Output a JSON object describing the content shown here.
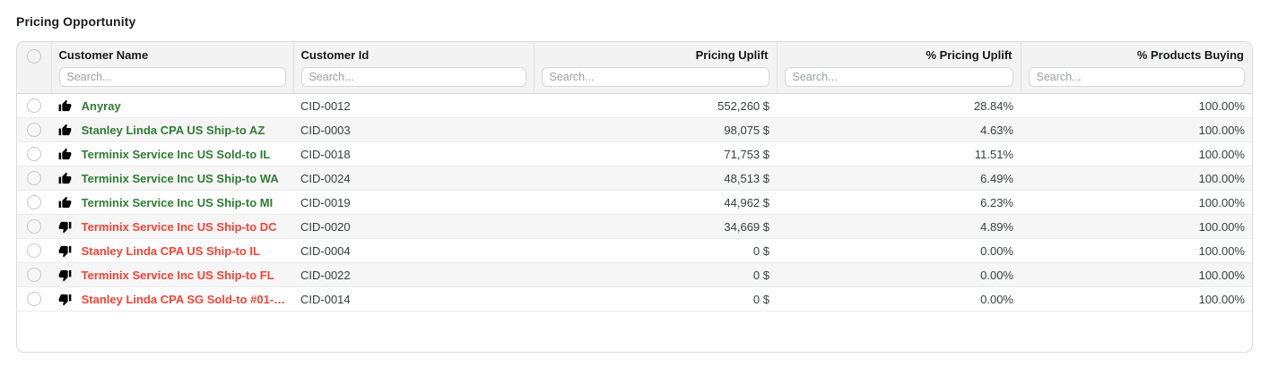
{
  "title": "Pricing Opportunity",
  "colors": {
    "positive": "#2e7d32",
    "negative": "#f44336",
    "thumb": "#f0b13c"
  },
  "table": {
    "search_placeholder": "Search...",
    "columns": [
      {
        "label": "Customer Name"
      },
      {
        "label": "Customer Id"
      },
      {
        "label": "Pricing Uplift"
      },
      {
        "label": "% Pricing Uplift"
      },
      {
        "label": "% Products Buying"
      }
    ],
    "rows": [
      {
        "sentiment": "up",
        "customer_name": "Anyray",
        "customer_id": "CID-0012",
        "pricing_uplift": "552,260 $",
        "pct_pricing_uplift": "28.84%",
        "pct_products_buying": "100.00%"
      },
      {
        "sentiment": "up",
        "customer_name": "Stanley Linda CPA US Ship-to AZ",
        "customer_id": "CID-0003",
        "pricing_uplift": "98,075 $",
        "pct_pricing_uplift": "4.63%",
        "pct_products_buying": "100.00%"
      },
      {
        "sentiment": "up",
        "customer_name": "Terminix Service Inc US Sold-to IL",
        "customer_id": "CID-0018",
        "pricing_uplift": "71,753 $",
        "pct_pricing_uplift": "11.51%",
        "pct_products_buying": "100.00%"
      },
      {
        "sentiment": "up",
        "customer_name": "Terminix Service Inc US Ship-to WA",
        "customer_id": "CID-0024",
        "pricing_uplift": "48,513 $",
        "pct_pricing_uplift": "6.49%",
        "pct_products_buying": "100.00%"
      },
      {
        "sentiment": "up",
        "customer_name": "Terminix Service Inc US Ship-to MI",
        "customer_id": "CID-0019",
        "pricing_uplift": "44,962 $",
        "pct_pricing_uplift": "6.23%",
        "pct_products_buying": "100.00%"
      },
      {
        "sentiment": "down",
        "customer_name": "Terminix Service Inc US Ship-to DC",
        "customer_id": "CID-0020",
        "pricing_uplift": "34,669 $",
        "pct_pricing_uplift": "4.89%",
        "pct_products_buying": "100.00%"
      },
      {
        "sentiment": "down",
        "customer_name": "Stanley Linda CPA US Ship-to IL",
        "customer_id": "CID-0004",
        "pricing_uplift": "0 $",
        "pct_pricing_uplift": "0.00%",
        "pct_products_buying": "100.00%"
      },
      {
        "sentiment": "down",
        "customer_name": "Terminix Service Inc US Ship-to FL",
        "customer_id": "CID-0022",
        "pricing_uplift": "0 $",
        "pct_pricing_uplift": "0.00%",
        "pct_products_buying": "100.00%"
      },
      {
        "sentiment": "down",
        "customer_name": "Stanley Linda CPA SG Sold-to #01-…",
        "customer_id": "CID-0014",
        "pricing_uplift": "0 $",
        "pct_pricing_uplift": "0.00%",
        "pct_products_buying": "100.00%"
      }
    ]
  }
}
